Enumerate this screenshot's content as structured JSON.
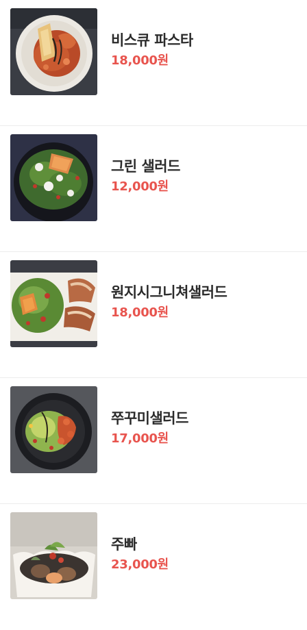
{
  "menu": {
    "items": [
      {
        "name": "비스큐 파스타",
        "price": "18,000원",
        "image": "bisque-pasta-photo"
      },
      {
        "name": "그린 샐러드",
        "price": "12,000원",
        "image": "green-salad-photo"
      },
      {
        "name": "원지시그니쳐샐러드",
        "price": "18,000원",
        "image": "signature-salad-photo"
      },
      {
        "name": "쭈꾸미샐러드",
        "price": "17,000원",
        "image": "webfoot-octopus-salad-photo"
      },
      {
        "name": "주빠",
        "price": "23,000원",
        "image": "jjuppa-photo"
      }
    ]
  }
}
